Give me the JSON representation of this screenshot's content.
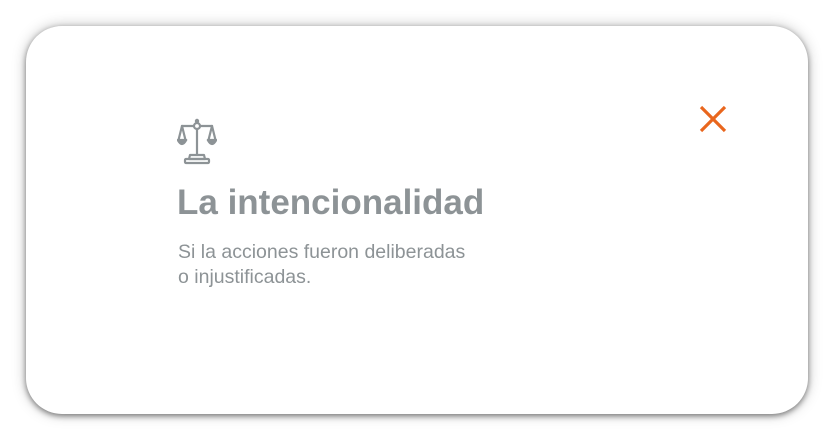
{
  "dialog": {
    "icon": "balance-scale-icon",
    "title": "La intencionalidad",
    "description_lines": [
      "Si la acciones fueron deliberadas",
      "o injustificadas."
    ],
    "close_icon": "close-icon"
  },
  "colors": {
    "text": "#8d9396",
    "accent": "#e9661d",
    "background": "#ffffff"
  }
}
